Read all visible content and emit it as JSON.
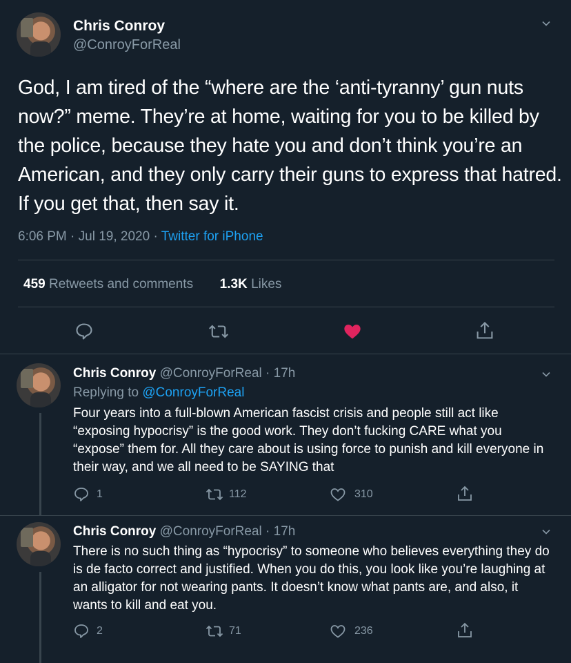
{
  "main_tweet": {
    "author_name": "Chris Conroy",
    "author_handle": "@ConroyForReal",
    "text": "God, I am tired of the “where are the ‘anti-tyranny’ gun nuts now?” meme. They’re at home, waiting for you to be killed by the police, because they hate you and don’t think you’re an American, and they only carry their guns to express that hatred. If you get that, then say it.",
    "time": "6:06 PM",
    "dot": "·",
    "date": "Jul 19, 2020",
    "source": "Twitter for iPhone",
    "retweets_count": "459",
    "retweets_label": "Retweets and comments",
    "likes_count": "1.3K",
    "likes_label": "Likes",
    "liked": true
  },
  "replies": [
    {
      "author_name": "Chris Conroy",
      "author_handle": "@ConroyForReal",
      "age": "17h",
      "replying_label": "Replying to",
      "replying_to": "@ConroyForReal",
      "text": "Four years into a full-blown American fascist crisis and people still act like “exposing hypocrisy” is the good work. They don’t fucking CARE what you “expose” them for. All they care about is using force to punish and kill everyone in their way, and we all need to be SAYING that",
      "comments": "1",
      "retweets": "112",
      "likes": "310"
    },
    {
      "author_name": "Chris Conroy",
      "author_handle": "@ConroyForReal",
      "age": "17h",
      "text": "There is no such thing as “hypocrisy” to someone who believes everything they do is de facto correct and justified. When you do this, you look like you’re laughing at an alligator for not wearing pants. It doesn’t know what pants are, and also, it wants to kill and eat you.",
      "comments": "2",
      "retweets": "71",
      "likes": "236"
    }
  ],
  "colors": {
    "background": "#15202b",
    "muted": "#8899a6",
    "link": "#1da1f2",
    "like_active": "#e0245e",
    "divider": "#38444d"
  },
  "icons": [
    "comment-icon",
    "retweet-icon",
    "heart-icon",
    "share-icon",
    "chevron-down-icon"
  ]
}
